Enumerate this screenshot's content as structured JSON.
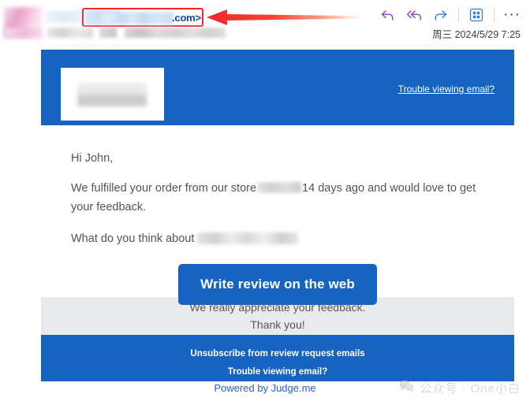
{
  "mail_header": {
    "sender_email_tld": ".com>",
    "timestamp": "周三 2024/5/29 7:25",
    "actions": [
      {
        "name": "reply-icon",
        "label": "Reply"
      },
      {
        "name": "reply-all-icon",
        "label": "Reply all"
      },
      {
        "name": "forward-icon",
        "label": "Forward"
      },
      {
        "name": "apps-grid-icon",
        "label": "Apps"
      },
      {
        "name": "more-options-icon",
        "label": "More options"
      }
    ],
    "more_glyph": "···"
  },
  "email": {
    "banner": {
      "trouble_link": "Trouble viewing email?"
    },
    "body": {
      "greeting": "Hi John,",
      "paragraph_1_before": "We fulfilled your order from our store",
      "paragraph_1_after": "14 days ago and would love to get your feedback.",
      "paragraph_2_before": "What do you think about",
      "cta_label": "Write review on the web"
    },
    "thanks": {
      "line_1": "We really appreciate your feedback.",
      "line_2": "Thank you!"
    },
    "footer": {
      "unsubscribe_link": "Unsubscribe from review request emails",
      "trouble_link": "Trouble viewing email?"
    },
    "powered_by": "Powered by Judge.me"
  },
  "watermark": {
    "text": "公众号 · One小白"
  },
  "colors": {
    "brand_blue": "#1664c0",
    "annotation_red": "#f5232a",
    "link_blue": "#2b62c9",
    "grey_panel": "#e8eaed",
    "body_text": "#545454"
  }
}
